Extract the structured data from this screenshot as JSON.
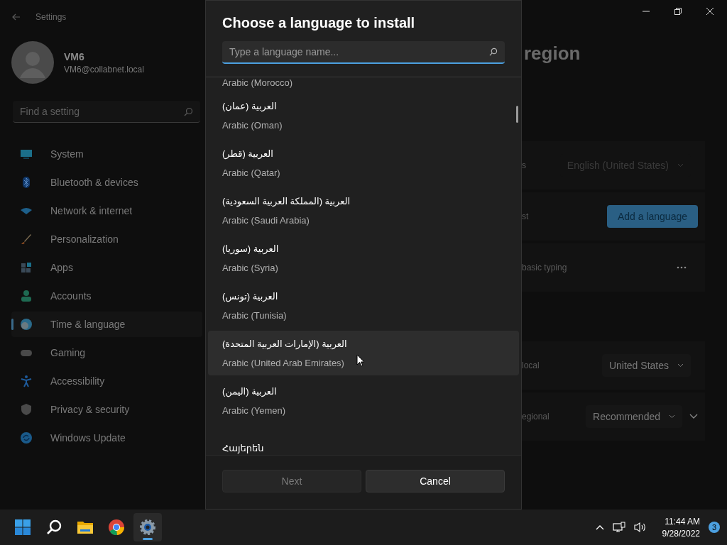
{
  "window": {
    "title": "Settings"
  },
  "account": {
    "name": "VM6",
    "email": "VM6@collabnet.local"
  },
  "search": {
    "placeholder": "Find a setting"
  },
  "nav": [
    {
      "label": "System",
      "kind": "system",
      "selected": false
    },
    {
      "label": "Bluetooth & devices",
      "kind": "bluetooth",
      "selected": false
    },
    {
      "label": "Network & internet",
      "kind": "network",
      "selected": false
    },
    {
      "label": "Personalization",
      "kind": "brush",
      "selected": false
    },
    {
      "label": "Apps",
      "kind": "apps",
      "selected": false
    },
    {
      "label": "Accounts",
      "kind": "person",
      "selected": false
    },
    {
      "label": "Time & language",
      "kind": "time",
      "selected": true
    },
    {
      "label": "Gaming",
      "kind": "gaming",
      "selected": false
    },
    {
      "label": "Accessibility",
      "kind": "accessibility",
      "selected": false
    },
    {
      "label": "Privacy & security",
      "kind": "shield",
      "selected": false
    },
    {
      "label": "Windows Update",
      "kind": "update",
      "selected": false
    }
  ],
  "page": {
    "title_fragment": "region",
    "rows": [
      {
        "kind": "dropdown",
        "label": "s",
        "value": "English (United States)",
        "disabled": true
      },
      {
        "kind": "button",
        "label": "st",
        "button": "Add a language"
      },
      {
        "kind": "more",
        "label": "basic typing"
      },
      {
        "kind": "dropdown",
        "label": "local",
        "value": "United States",
        "disabled": false
      },
      {
        "kind": "expand",
        "label": "egional",
        "value": "Recommended",
        "disabled": false
      }
    ]
  },
  "dialog": {
    "title": "Choose a language to install",
    "search_placeholder": "Type a language name...",
    "languages": [
      {
        "english": "Arabic (Morocco)",
        "highlighted": false
      },
      {
        "native": "العربية (عمان)",
        "english": "Arabic (Oman)",
        "highlighted": false
      },
      {
        "native": "العربية (قطر)",
        "english": "Arabic (Qatar)",
        "highlighted": false
      },
      {
        "native": "العربية (المملكة العربية السعودية)",
        "english": "Arabic (Saudi Arabia)",
        "highlighted": false
      },
      {
        "native": "العربية (سوريا)",
        "english": "Arabic (Syria)",
        "highlighted": false
      },
      {
        "native": "العربية (تونس)",
        "english": "Arabic (Tunisia)",
        "highlighted": false
      },
      {
        "native": "العربية (الإمارات العربية المتحدة)",
        "english": "Arabic (United Arab Emirates)",
        "highlighted": true
      },
      {
        "native": "العربية (اليمن)",
        "english": "Arabic (Yemen)",
        "highlighted": false
      },
      {
        "native": "Հայերեն",
        "highlighted": false
      }
    ],
    "buttons": [
      {
        "label": "Next",
        "disabled": true
      },
      {
        "label": "Cancel",
        "disabled": false
      }
    ]
  },
  "taskbar": {
    "apps": [
      {
        "kind": "start",
        "active": false
      },
      {
        "kind": "search",
        "active": false
      },
      {
        "kind": "folder",
        "active": false
      },
      {
        "kind": "browser",
        "active": false
      },
      {
        "kind": "settings",
        "active": true
      }
    ],
    "time": "11:44 AM",
    "date": "9/28/2022",
    "badge": "3"
  }
}
